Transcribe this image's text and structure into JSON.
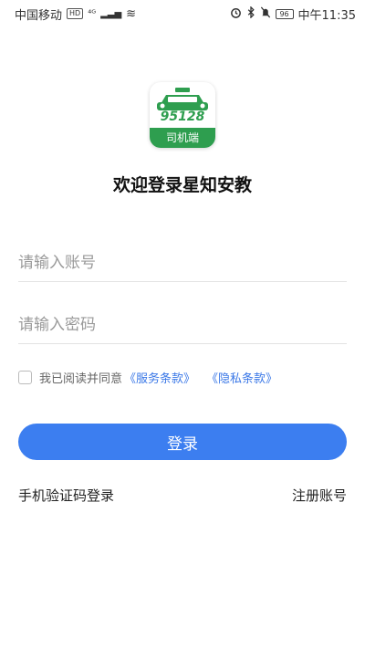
{
  "status_bar": {
    "carrier": "中国移动",
    "hd_badge": "HD",
    "network": "⁴ᴳ",
    "signal": "▂▃▅",
    "wifi": "≋",
    "battery": "96",
    "time": "中午11:35"
  },
  "logo": {
    "number": "95128",
    "caption": "司机端"
  },
  "title": "欢迎登录星知安教",
  "account_input": {
    "placeholder": "请输入账号"
  },
  "password_input": {
    "placeholder": "请输入密码"
  },
  "agreement": {
    "prefix": "我已阅读并同意",
    "service_link": "《服务条款》",
    "privacy_link": "《隐私条款》"
  },
  "login_button": "登录",
  "sms_login": "手机验证码登录",
  "register": "注册账号",
  "colors": {
    "primary": "#3c7ef0",
    "link": "#3b78e7",
    "brand_green": "#2e9e4f"
  }
}
